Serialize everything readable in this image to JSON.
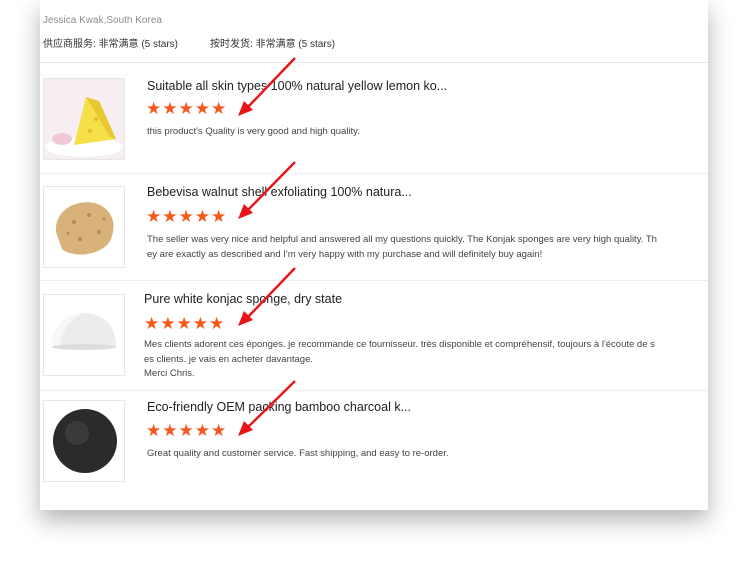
{
  "reviewer": {
    "name_location": "Jessica Kwak,South Korea",
    "supplier_service": "供应商服务: 非常满意 (5 stars)",
    "on_time_shipment": "按时发货: 非常满意 (5 stars)"
  },
  "reviews": [
    {
      "product_title": "Suitable all skin types 100% natural yellow lemon ko...",
      "rating": 5,
      "text_lines": [
        "this product's Quality is very good and high quality."
      ],
      "image_icon": "yellow-lemon-sponge-image"
    },
    {
      "product_title": "Bebevisa walnut shell exfoliating 100% natura...",
      "rating": 5,
      "text_lines": [
        "The seller was very nice and helpful and answered all my questions quickly. The Konjak sponges are very high quality. Th",
        "ey are exactly as described and I'm very happy with my purchase and will definitely buy again!"
      ],
      "image_icon": "walnut-shell-sponge-image"
    },
    {
      "product_title": "Pure white konjac sponge, dry state",
      "rating": 5,
      "text_lines": [
        "Mes clients adorent ces éponges.  je recommande ce fournisseur. très disponible et compréhensif, toujours à l'écoute de s",
        "es clients. je vais en acheter davantage.",
        "Merci Chris."
      ],
      "image_icon": "white-konjac-sponge-image"
    },
    {
      "product_title": "Eco-friendly OEM packing bamboo charcoal k...",
      "rating": 5,
      "text_lines": [
        "Great quality and customer service. Fast shipping, and easy to re-order."
      ],
      "image_icon": "charcoal-konjac-sponge-image"
    }
  ],
  "colors": {
    "star": "#f4581b",
    "arrow": "#e8141a"
  }
}
